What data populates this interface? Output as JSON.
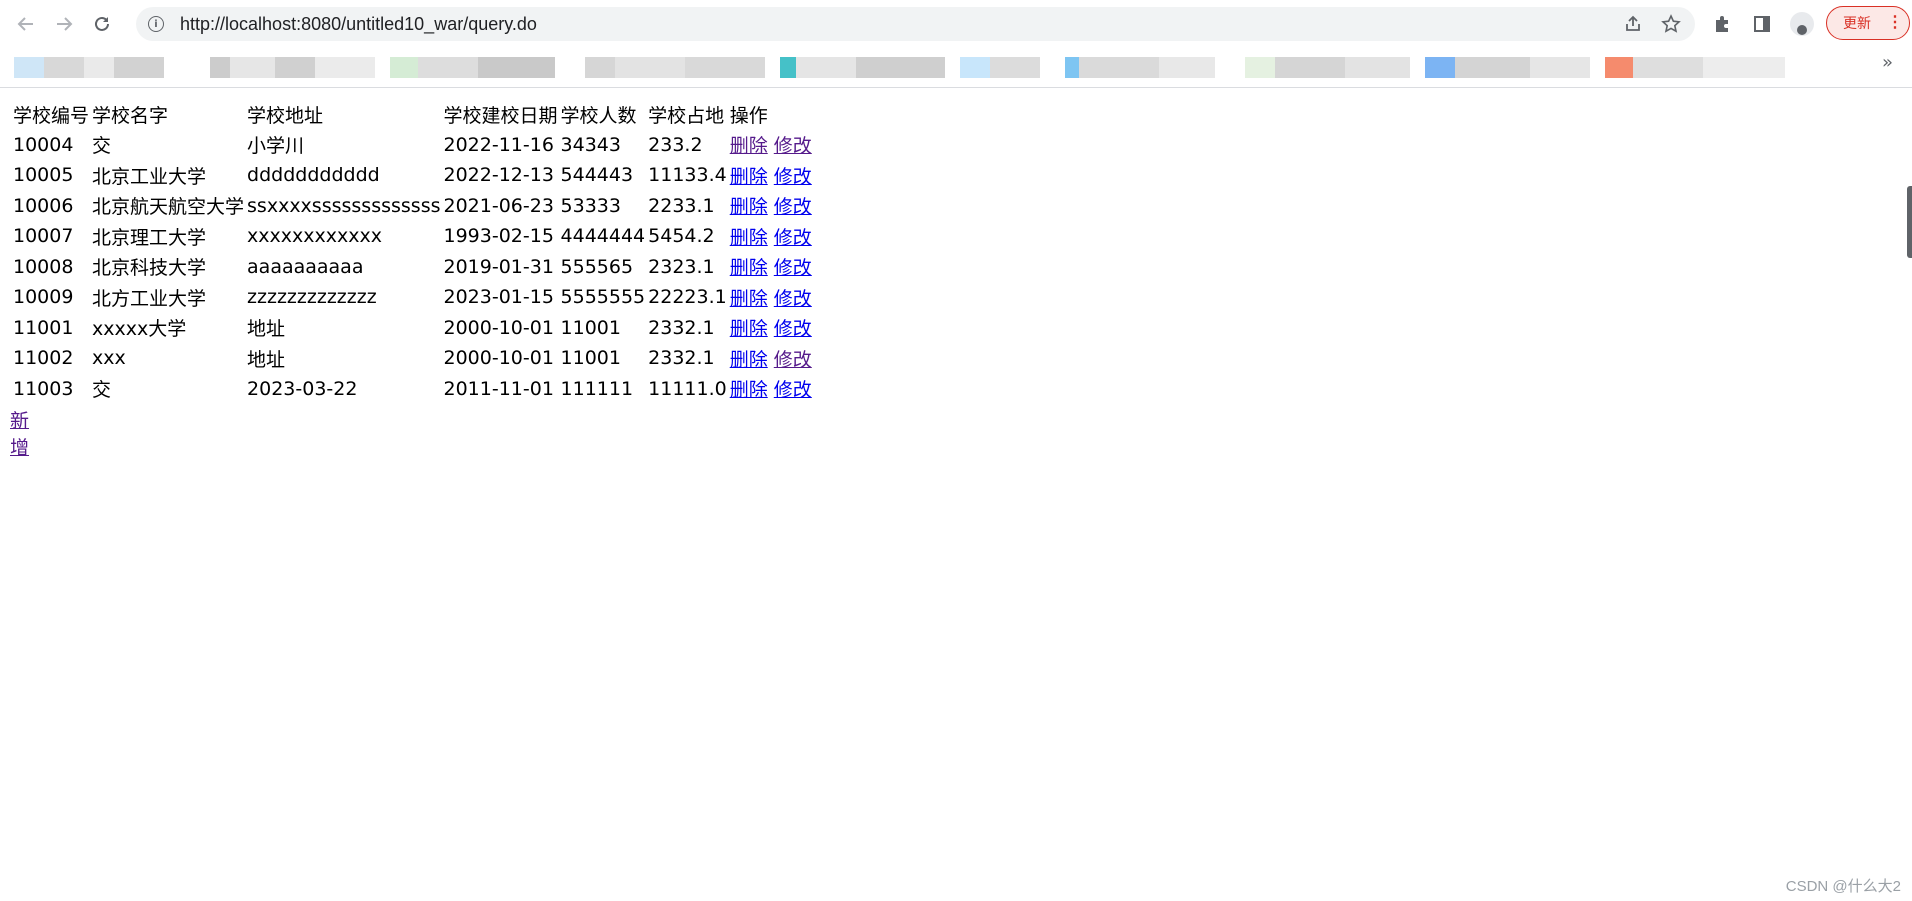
{
  "browser": {
    "url": "http://localhost:8080/untitled10_war/query.do",
    "update_label": "更新",
    "icons": {
      "back": "arrow-left-icon",
      "forward": "arrow-right-icon",
      "reload": "reload-icon",
      "site_info": "info-icon",
      "share": "share-icon",
      "bookmark": "star-icon",
      "extensions": "puzzle-icon",
      "side_panel": "side-panel-icon",
      "profile": "profile-icon",
      "menu": "kebab-menu-icon",
      "more_bookmarks": "chevron-double-right-icon"
    },
    "more_bookmarks_glyph": "»"
  },
  "table": {
    "headers": [
      "学校编号",
      "学校名字",
      "学校地址",
      "学校建校日期",
      "学校人数",
      "学校占地",
      "操作"
    ],
    "rows": [
      {
        "id": "10004",
        "name": "交",
        "address": "小学川",
        "date": "2022-11-16",
        "count": "34343",
        "area": "233.2"
      },
      {
        "id": "10005",
        "name": "北京工业大学",
        "address": "ddddddddddd",
        "date": "2022-12-13",
        "count": "544443",
        "area": "11133.4"
      },
      {
        "id": "10006",
        "name": "北京航天航空大学",
        "address": "ssxxxxsssssssssssss",
        "date": "2021-06-23",
        "count": "53333",
        "area": "2233.1"
      },
      {
        "id": "10007",
        "name": "北京理工大学",
        "address": "xxxxxxxxxxxx",
        "date": "1993-02-15",
        "count": "4444444",
        "area": "5454.2"
      },
      {
        "id": "10008",
        "name": "北京科技大学",
        "address": "aaaaaaaaaa",
        "date": "2019-01-31",
        "count": "555565",
        "area": "2323.1"
      },
      {
        "id": "10009",
        "name": "北方工业大学",
        "address": "zzzzzzzzzzzzz",
        "date": "2023-01-15",
        "count": "5555555",
        "area": "22223.1"
      },
      {
        "id": "11001",
        "name": "xxxxx大学",
        "address": "地址",
        "date": "2000-10-01",
        "count": "11001",
        "area": "2332.1"
      },
      {
        "id": "11002",
        "name": "xxx",
        "address": "地址",
        "date": "2000-10-01",
        "count": "11001",
        "area": "2332.1"
      },
      {
        "id": "11003",
        "name": "交",
        "address": "2023-03-22",
        "date": "2011-11-01",
        "count": "111111",
        "area": "11111.0"
      }
    ],
    "delete_label": "删除",
    "edit_label": "修改"
  },
  "add_label": "新增",
  "watermark": "CSDN @什么大2",
  "colors": {
    "link": "#0000ee",
    "visited_link": "#551a8b",
    "update_accent": "#d93025"
  }
}
